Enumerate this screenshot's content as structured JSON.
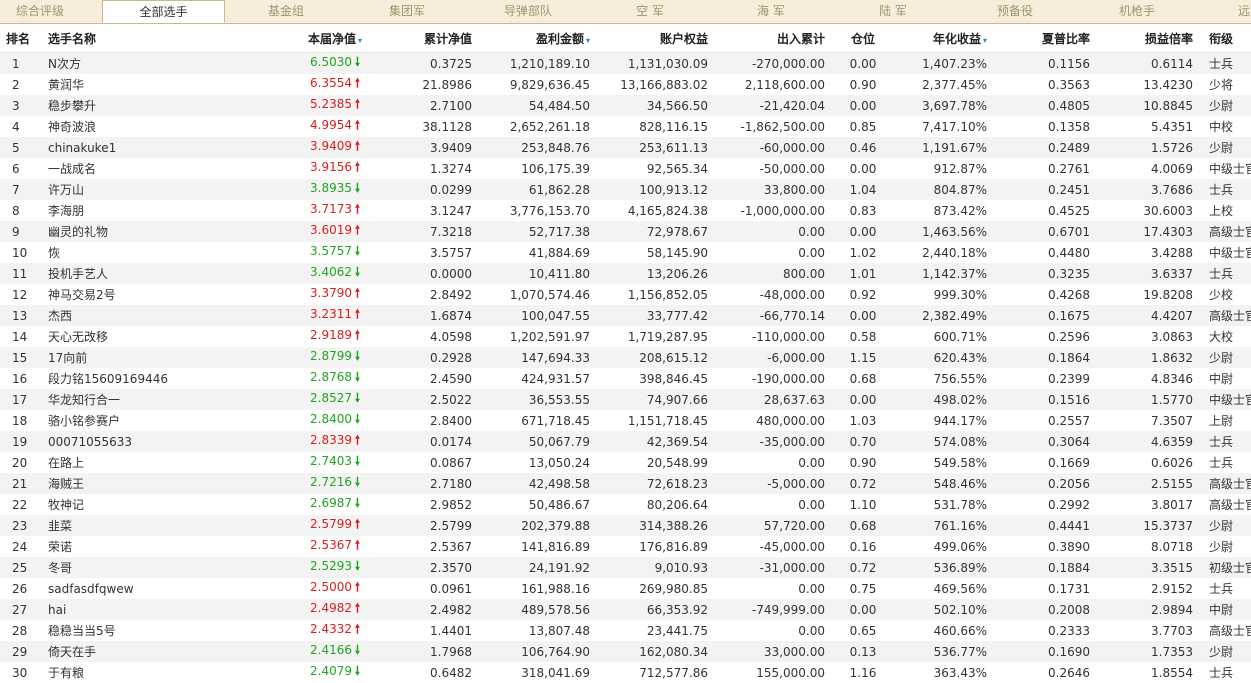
{
  "tabs": [
    {
      "label": "综合评级",
      "active": false
    },
    {
      "label": "全部选手",
      "active": true
    },
    {
      "label": "基金组",
      "active": false
    },
    {
      "label": "集团军",
      "active": false
    },
    {
      "label": "导弹部队",
      "active": false
    },
    {
      "label": "空  军",
      "active": false
    },
    {
      "label": "海  军",
      "active": false
    },
    {
      "label": "陆  军",
      "active": false
    },
    {
      "label": "预备役",
      "active": false
    },
    {
      "label": "机枪手",
      "active": false
    },
    {
      "label": "远",
      "active": false
    }
  ],
  "columns": {
    "rank": "排名",
    "name": "选手名称",
    "nav": "本届净值",
    "cum_nav": "累计净值",
    "profit": "盈利金额",
    "equity": "账户权益",
    "inout": "出入累计",
    "position": "仓位",
    "annual": "年化收益",
    "sharpe": "夏普比率",
    "pl_ratio": "损益倍率",
    "rank_title": "衔级"
  },
  "sort_icon": "▾",
  "arrows": {
    "up": "🠕",
    "down": "🠗"
  },
  "rows": [
    {
      "rank": "1",
      "name": "N次方",
      "nav": "6.5030",
      "dir": "down",
      "cum_nav": "0.3725",
      "profit": "1,210,189.10",
      "equity": "1,131,030.09",
      "inout": "-270,000.00",
      "position": "0.00",
      "annual": "1,407.23%",
      "sharpe": "0.1156",
      "pl_ratio": "0.6114",
      "title": "士兵"
    },
    {
      "rank": "2",
      "name": "黄润华",
      "nav": "6.3554",
      "dir": "up",
      "cum_nav": "21.8986",
      "profit": "9,829,636.45",
      "equity": "13,166,883.02",
      "inout": "2,118,600.00",
      "position": "0.90",
      "annual": "2,377.45%",
      "sharpe": "0.3563",
      "pl_ratio": "13.4230",
      "title": "少将"
    },
    {
      "rank": "3",
      "name": "稳步攀升",
      "nav": "5.2385",
      "dir": "up",
      "cum_nav": "2.7100",
      "profit": "54,484.50",
      "equity": "34,566.50",
      "inout": "-21,420.04",
      "position": "0.00",
      "annual": "3,697.78%",
      "sharpe": "0.4805",
      "pl_ratio": "10.8845",
      "title": "少尉"
    },
    {
      "rank": "4",
      "name": "神奇波浪",
      "nav": "4.9954",
      "dir": "up",
      "cum_nav": "38.1128",
      "profit": "2,652,261.18",
      "equity": "828,116.15",
      "inout": "-1,862,500.00",
      "position": "0.85",
      "annual": "7,417.10%",
      "sharpe": "0.1358",
      "pl_ratio": "5.4351",
      "title": "中校"
    },
    {
      "rank": "5",
      "name": "chinakuke1",
      "nav": "3.9409",
      "dir": "up",
      "cum_nav": "3.9409",
      "profit": "253,848.76",
      "equity": "253,611.13",
      "inout": "-60,000.00",
      "position": "0.46",
      "annual": "1,191.67%",
      "sharpe": "0.2489",
      "pl_ratio": "1.5726",
      "title": "少尉"
    },
    {
      "rank": "6",
      "name": "一战成名",
      "nav": "3.9156",
      "dir": "up",
      "cum_nav": "1.3274",
      "profit": "106,175.39",
      "equity": "92,565.34",
      "inout": "-50,000.00",
      "position": "0.00",
      "annual": "912.87%",
      "sharpe": "0.2761",
      "pl_ratio": "4.0069",
      "title": "中级士官"
    },
    {
      "rank": "7",
      "name": "许万山",
      "nav": "3.8935",
      "dir": "down",
      "cum_nav": "0.0299",
      "profit": "61,862.28",
      "equity": "100,913.12",
      "inout": "33,800.00",
      "position": "1.04",
      "annual": "804.87%",
      "sharpe": "0.2451",
      "pl_ratio": "3.7686",
      "title": "士兵"
    },
    {
      "rank": "8",
      "name": "李海朋",
      "nav": "3.7173",
      "dir": "up",
      "cum_nav": "3.1247",
      "profit": "3,776,153.70",
      "equity": "4,165,824.38",
      "inout": "-1,000,000.00",
      "position": "0.83",
      "annual": "873.42%",
      "sharpe": "0.4525",
      "pl_ratio": "30.6003",
      "title": "上校"
    },
    {
      "rank": "9",
      "name": "幽灵的礼物",
      "nav": "3.6019",
      "dir": "up",
      "cum_nav": "7.3218",
      "profit": "52,717.38",
      "equity": "72,978.67",
      "inout": "0.00",
      "position": "0.00",
      "annual": "1,463.56%",
      "sharpe": "0.6701",
      "pl_ratio": "17.4303",
      "title": "高级士官"
    },
    {
      "rank": "10",
      "name": "恢",
      "nav": "3.5757",
      "dir": "down",
      "cum_nav": "3.5757",
      "profit": "41,884.69",
      "equity": "58,145.90",
      "inout": "0.00",
      "position": "1.02",
      "annual": "2,440.18%",
      "sharpe": "0.4480",
      "pl_ratio": "3.4288",
      "title": "中级士官"
    },
    {
      "rank": "11",
      "name": "投机手艺人",
      "nav": "3.4062",
      "dir": "down",
      "cum_nav": "0.0000",
      "profit": "10,411.80",
      "equity": "13,206.26",
      "inout": "800.00",
      "position": "1.01",
      "annual": "1,142.37%",
      "sharpe": "0.3235",
      "pl_ratio": "3.6337",
      "title": "士兵"
    },
    {
      "rank": "12",
      "name": "神马交易2号",
      "nav": "3.3790",
      "dir": "up",
      "cum_nav": "2.8492",
      "profit": "1,070,574.46",
      "equity": "1,156,852.05",
      "inout": "-48,000.00",
      "position": "0.92",
      "annual": "999.30%",
      "sharpe": "0.4268",
      "pl_ratio": "19.8208",
      "title": "少校"
    },
    {
      "rank": "13",
      "name": "杰西",
      "nav": "3.2311",
      "dir": "up",
      "cum_nav": "1.6874",
      "profit": "100,047.55",
      "equity": "33,777.42",
      "inout": "-66,770.14",
      "position": "0.00",
      "annual": "2,382.49%",
      "sharpe": "0.1675",
      "pl_ratio": "4.4207",
      "title": "高级士官"
    },
    {
      "rank": "14",
      "name": "天心无改移",
      "nav": "2.9189",
      "dir": "up",
      "cum_nav": "4.0598",
      "profit": "1,202,591.97",
      "equity": "1,719,287.95",
      "inout": "-110,000.00",
      "position": "0.58",
      "annual": "600.71%",
      "sharpe": "0.2596",
      "pl_ratio": "3.0863",
      "title": "大校"
    },
    {
      "rank": "15",
      "name": "17向前",
      "nav": "2.8799",
      "dir": "down",
      "cum_nav": "0.2928",
      "profit": "147,694.33",
      "equity": "208,615.12",
      "inout": "-6,000.00",
      "position": "1.15",
      "annual": "620.43%",
      "sharpe": "0.1864",
      "pl_ratio": "1.8632",
      "title": "少尉"
    },
    {
      "rank": "16",
      "name": "段力铭15609169446",
      "nav": "2.8768",
      "dir": "down",
      "cum_nav": "2.4590",
      "profit": "424,931.57",
      "equity": "398,846.45",
      "inout": "-190,000.00",
      "position": "0.68",
      "annual": "756.55%",
      "sharpe": "0.2399",
      "pl_ratio": "4.8346",
      "title": "中尉"
    },
    {
      "rank": "17",
      "name": "华龙知行合一",
      "nav": "2.8527",
      "dir": "down",
      "cum_nav": "2.5022",
      "profit": "36,553.55",
      "equity": "74,907.66",
      "inout": "28,637.63",
      "position": "0.00",
      "annual": "498.02%",
      "sharpe": "0.1516",
      "pl_ratio": "1.5770",
      "title": "中级士官"
    },
    {
      "rank": "18",
      "name": "骆小铭参赛户",
      "nav": "2.8400",
      "dir": "down",
      "cum_nav": "2.8400",
      "profit": "671,718.45",
      "equity": "1,151,718.45",
      "inout": "480,000.00",
      "position": "1.03",
      "annual": "944.17%",
      "sharpe": "0.2557",
      "pl_ratio": "7.3507",
      "title": "上尉"
    },
    {
      "rank": "19",
      "name": "00071055633",
      "nav": "2.8339",
      "dir": "up",
      "cum_nav": "0.0174",
      "profit": "50,067.79",
      "equity": "42,369.54",
      "inout": "-35,000.00",
      "position": "0.70",
      "annual": "574.08%",
      "sharpe": "0.3064",
      "pl_ratio": "4.6359",
      "title": "士兵"
    },
    {
      "rank": "20",
      "name": "在路上",
      "nav": "2.7403",
      "dir": "down",
      "cum_nav": "0.0867",
      "profit": "13,050.24",
      "equity": "20,548.99",
      "inout": "0.00",
      "position": "0.90",
      "annual": "549.58%",
      "sharpe": "0.1669",
      "pl_ratio": "0.6026",
      "title": "士兵"
    },
    {
      "rank": "21",
      "name": "海贼王",
      "nav": "2.7216",
      "dir": "down",
      "cum_nav": "2.7180",
      "profit": "42,498.58",
      "equity": "72,618.23",
      "inout": "-5,000.00",
      "position": "0.72",
      "annual": "548.46%",
      "sharpe": "0.2056",
      "pl_ratio": "2.5155",
      "title": "高级士官"
    },
    {
      "rank": "22",
      "name": "牧神记",
      "nav": "2.6987",
      "dir": "down",
      "cum_nav": "2.9852",
      "profit": "50,486.67",
      "equity": "80,206.64",
      "inout": "0.00",
      "position": "1.10",
      "annual": "531.78%",
      "sharpe": "0.2992",
      "pl_ratio": "3.8017",
      "title": "高级士官"
    },
    {
      "rank": "23",
      "name": "韭菜",
      "nav": "2.5799",
      "dir": "up",
      "cum_nav": "2.5799",
      "profit": "202,379.88",
      "equity": "314,388.26",
      "inout": "57,720.00",
      "position": "0.68",
      "annual": "761.16%",
      "sharpe": "0.4441",
      "pl_ratio": "15.3737",
      "title": "少尉"
    },
    {
      "rank": "24",
      "name": "荣诺",
      "nav": "2.5367",
      "dir": "up",
      "cum_nav": "2.5367",
      "profit": "141,816.89",
      "equity": "176,816.89",
      "inout": "-45,000.00",
      "position": "0.16",
      "annual": "499.06%",
      "sharpe": "0.3890",
      "pl_ratio": "8.0718",
      "title": "少尉"
    },
    {
      "rank": "25",
      "name": "冬哥",
      "nav": "2.5293",
      "dir": "down",
      "cum_nav": "2.3570",
      "profit": "24,191.92",
      "equity": "9,010.93",
      "inout": "-31,000.00",
      "position": "0.72",
      "annual": "536.89%",
      "sharpe": "0.1884",
      "pl_ratio": "3.3515",
      "title": "初级士官"
    },
    {
      "rank": "26",
      "name": "sadfasdfqwew",
      "nav": "2.5000",
      "dir": "up",
      "cum_nav": "0.0961",
      "profit": "161,988.16",
      "equity": "269,980.85",
      "inout": "0.00",
      "position": "0.75",
      "annual": "469.56%",
      "sharpe": "0.1731",
      "pl_ratio": "2.9152",
      "title": "士兵"
    },
    {
      "rank": "27",
      "name": "hai",
      "nav": "2.4982",
      "dir": "up",
      "cum_nav": "2.4982",
      "profit": "489,578.56",
      "equity": "66,353.92",
      "inout": "-749,999.00",
      "position": "0.00",
      "annual": "502.10%",
      "sharpe": "0.2008",
      "pl_ratio": "2.9894",
      "title": "中尉"
    },
    {
      "rank": "28",
      "name": "稳稳当当5号",
      "nav": "2.4332",
      "dir": "up",
      "cum_nav": "1.4401",
      "profit": "13,807.48",
      "equity": "23,441.75",
      "inout": "0.00",
      "position": "0.65",
      "annual": "460.66%",
      "sharpe": "0.2333",
      "pl_ratio": "3.7703",
      "title": "高级士官"
    },
    {
      "rank": "29",
      "name": "倚天在手",
      "nav": "2.4166",
      "dir": "down",
      "cum_nav": "1.7968",
      "profit": "106,764.90",
      "equity": "162,080.34",
      "inout": "33,000.00",
      "position": "0.13",
      "annual": "536.77%",
      "sharpe": "0.1690",
      "pl_ratio": "1.7353",
      "title": "少尉"
    },
    {
      "rank": "30",
      "name": "于有粮",
      "nav": "2.4079",
      "dir": "down",
      "cum_nav": "0.6482",
      "profit": "318,041.69",
      "equity": "712,577.86",
      "inout": "155,000.00",
      "position": "1.16",
      "annual": "363.43%",
      "sharpe": "0.2646",
      "pl_ratio": "1.8554",
      "title": "士兵"
    }
  ]
}
